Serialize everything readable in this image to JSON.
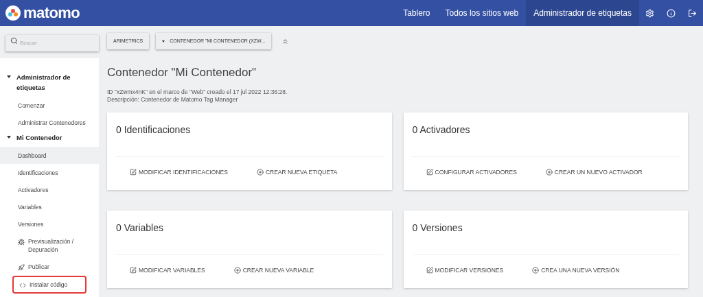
{
  "header": {
    "logo": "matomo",
    "nav": [
      {
        "label": "Tablero",
        "selected": false
      },
      {
        "label": "Todos los sitios web",
        "selected": false
      },
      {
        "label": "Administrador de etiquetas",
        "selected": true
      }
    ]
  },
  "search": {
    "placeholder": "Buscar"
  },
  "selectors": [
    {
      "kind": "button",
      "label": "ARIMETRICS"
    },
    {
      "kind": "dropdown",
      "label": "CONTENEDOR \"MI CONTENEDOR (XZW..."
    }
  ],
  "sidebar": {
    "groups": [
      {
        "title": "Administrador de etiquetas",
        "expanded": true,
        "items": [
          {
            "label": "Comenzar",
            "selected": false,
            "highlighted": false
          },
          {
            "label": "Administrar Contenedores",
            "selected": false,
            "highlighted": false
          }
        ]
      },
      {
        "title": "Mi Contenedor",
        "expanded": true,
        "items": [
          {
            "label": "Dashboard",
            "selected": true,
            "highlighted": false
          },
          {
            "label": "Identificaciones",
            "selected": false,
            "highlighted": false
          },
          {
            "label": "Activadores",
            "selected": false,
            "highlighted": false
          },
          {
            "label": "Variables",
            "selected": false,
            "highlighted": false
          },
          {
            "label": "Versiones",
            "selected": false,
            "highlighted": false
          },
          {
            "label": "Previsualización / Depuración",
            "kind": "debug",
            "selected": false,
            "highlighted": false
          },
          {
            "label": "Publicar",
            "kind": "publish",
            "selected": false,
            "highlighted": false
          },
          {
            "label": "Instalar código",
            "kind": "code",
            "selected": false,
            "highlighted": true
          }
        ]
      }
    ]
  },
  "page": {
    "title": "Contenedor \"Mi Contenedor\"",
    "meta": "ID \"xZwmx4nK\" en el marco de \"Web\" creado el 17 jul 2022 12:36:28.",
    "description": "Descripción: Contenedor de Matomo Tag Manager"
  },
  "cards": [
    {
      "title": "0 Identificaciones",
      "actions": [
        {
          "kind": "edit",
          "label": "MODIFICAR IDENTIFICACIONES"
        },
        {
          "kind": "add",
          "label": "CREAR NUEVA ETIQUETA"
        }
      ]
    },
    {
      "title": "0 Activadores",
      "actions": [
        {
          "kind": "edit",
          "label": "CONFIGURAR ACTIVADORES"
        },
        {
          "kind": "add",
          "label": "CREAR UN NUEVO ACTIVADOR"
        }
      ]
    },
    {
      "title": "0 Variables",
      "actions": [
        {
          "kind": "edit",
          "label": "MODIFICAR VARIABLES"
        },
        {
          "kind": "add",
          "label": "CREAR NUEVA VARIABLE"
        }
      ]
    },
    {
      "title": "0 Versiones",
      "actions": [
        {
          "kind": "edit",
          "label": "MODIFICAR VERSIONES"
        },
        {
          "kind": "add",
          "label": "CREA UNA NUEVA VERSIÓN"
        }
      ]
    }
  ]
}
